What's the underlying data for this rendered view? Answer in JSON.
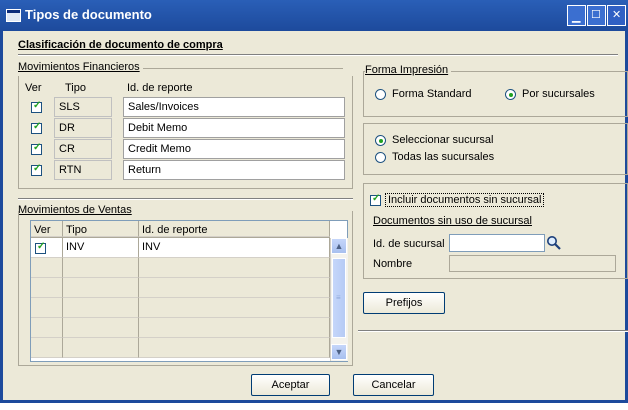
{
  "window": {
    "title": "Tipos de documento"
  },
  "section_title": "Clasificación de documento de compra ",
  "financieros": {
    "group_label": "Movimientos Financieros",
    "columns": [
      "Ver",
      "Tipo",
      "Id. de reporte"
    ],
    "rows": [
      {
        "tipo": "SLS",
        "id": "Sales/Invoices",
        "checked": true
      },
      {
        "tipo": "DR",
        "id": "Debit Memo",
        "checked": true
      },
      {
        "tipo": "CR",
        "id": "Credit Memo",
        "checked": true
      },
      {
        "tipo": "RTN",
        "id": "Return",
        "checked": true
      }
    ]
  },
  "ventas": {
    "group_label": "Movimientos de Ventas",
    "columns": [
      "Ver",
      "Tipo",
      "Id. de reporte"
    ],
    "rows": [
      {
        "tipo": "INV",
        "id": "INV",
        "checked": true
      }
    ]
  },
  "impresion": {
    "group_label": "Forma Impresión",
    "option_standard": "Forma Standard",
    "option_sucursales": "Por sucursales",
    "selected": "Por sucursales"
  },
  "sucursal": {
    "option_seleccionar": "Seleccionar sucursal",
    "option_todas": "Todas las sucursales",
    "selected": "Seleccionar sucursal"
  },
  "documentos": {
    "incluir_label": "Incluir documentos sin sucursal",
    "incluir_checked": true,
    "sin_uso_label": "Documentos sin uso de sucursal",
    "id_sucursal_label": "Id. de sucursal",
    "id_sucursal_value": "",
    "nombre_label": "Nombre",
    "nombre_value": ""
  },
  "buttons": {
    "prefijos": "Prefijos",
    "aceptar": "Aceptar",
    "cancelar": "Cancelar"
  },
  "colors": {
    "titlebar": "#1d4a9c",
    "window_bg": "#ece9d8",
    "check_green": "#21a121"
  }
}
